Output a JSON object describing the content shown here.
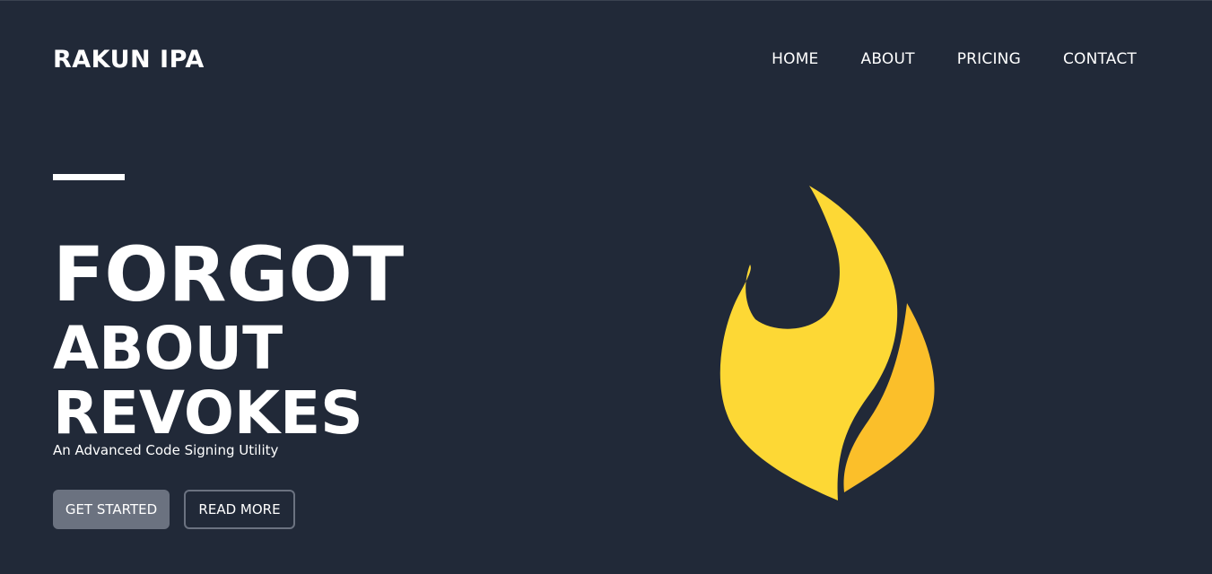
{
  "header": {
    "brand": "RAKUN IPA",
    "nav": [
      "HOME",
      "ABOUT",
      "PRICING",
      "CONTACT"
    ]
  },
  "hero": {
    "title_line1": "FORGOT",
    "title_line2": "ABOUT",
    "title_line3": "REVOKES",
    "tagline": "An Advanced Code Signing Utility",
    "primary_button": "GET STARTED",
    "secondary_button": "READ MORE"
  },
  "icons": {
    "hero_illustration": "flame-icon"
  },
  "colors": {
    "background": "#212938",
    "text": "#ffffff",
    "button_primary": "#6b7280",
    "flame_main": "#FDD835",
    "flame_secondary": "#FBBF2A"
  }
}
